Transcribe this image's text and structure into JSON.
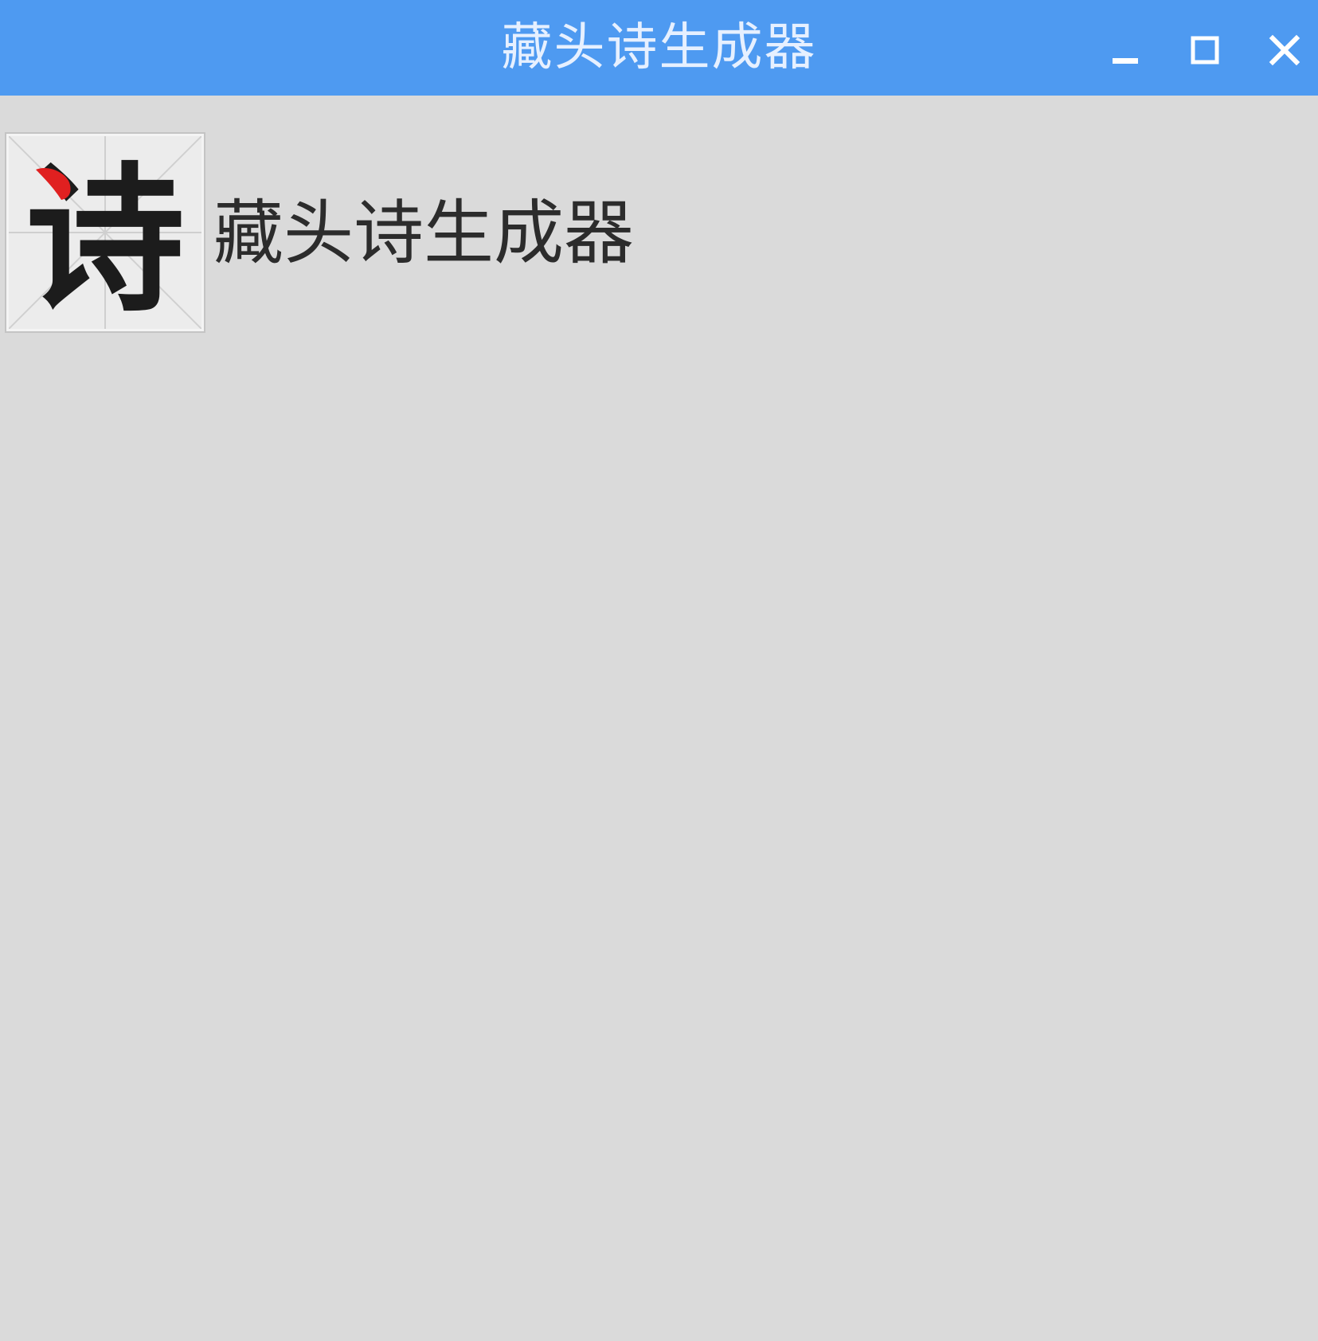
{
  "window": {
    "title": "藏头诗生成器",
    "titlebar_color": "#4e9af1",
    "controls": {
      "minimize_icon": "minimize-icon",
      "maximize_icon": "maximize-icon",
      "close_icon": "close-icon"
    }
  },
  "header": {
    "logo_glyph": "诗",
    "logo_accent_color": "#e02020",
    "app_label": "藏头诗生成器"
  },
  "colors": {
    "background": "#dadada",
    "text": "#2c2c2c"
  }
}
